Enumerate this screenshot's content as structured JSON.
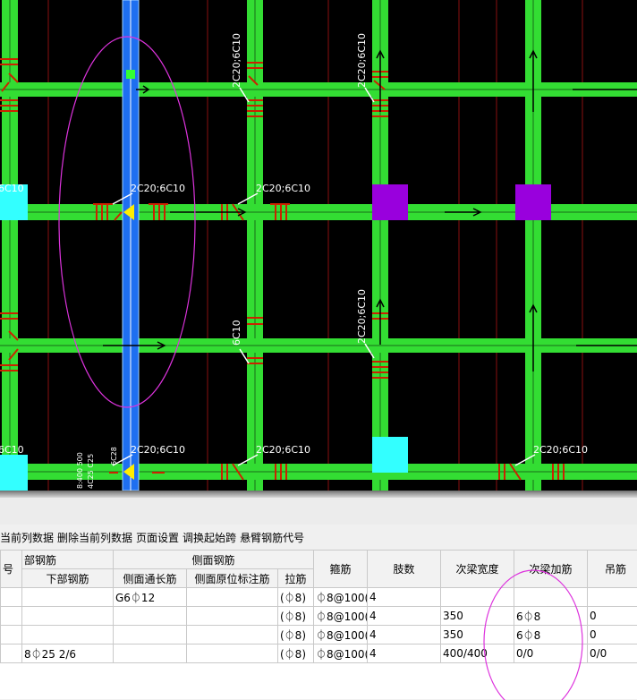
{
  "drawing": {
    "beam_labels": {
      "vertical_a": "2C20;6C10",
      "vertical_b": "2C20;6C10",
      "vertical_c": "2C20;6C10",
      "vertical_d": "6C10",
      "horizontal_a": "2C20;6C10",
      "horizontal_b": "2C20;6C10",
      "horizontal_c": "2C20;6C10",
      "horizontal_d": "2C20;6C10",
      "horizontal_e": "2C20;6C10",
      "edge_a": "6C10",
      "edge_b": "6C10",
      "bottom_small_a": "6C28",
      "bottom_small_b": "8:400 500",
      "bottom_small_c": "4C25 C25"
    },
    "colors": {
      "background": "#000000",
      "beam": "#33dd33",
      "selected_beam": "#1e6ff0",
      "column_cyan": "#33ffff",
      "column_purple": "#9900dd",
      "rebar_marks": "#cc2200",
      "axis_lines": "#8a1010",
      "selection_ellipse": "#dd33dd"
    }
  },
  "toolbar": {
    "items": [
      "当前列数据",
      "删除当前列数据",
      "页面设置",
      "调换起始跨",
      "悬臂钢筋代号"
    ]
  },
  "grid": {
    "group_headers": {
      "col0": "号",
      "bottom_rebar_group": "部钢筋",
      "side_rebar_group": "侧面钢筋"
    },
    "columns": {
      "bottom_rebar": "下部钢筋",
      "side_through": "侧面通长筋",
      "side_original": "侧面原位标注筋",
      "tie_bar": "拉筋",
      "stirrup": "箍筋",
      "legs": "肢数",
      "sec_beam_width": "次梁宽度",
      "sec_beam_rebar": "次梁加筋",
      "hanger": "吊筋"
    },
    "rows": [
      {
        "c0": "",
        "bottom": "",
        "side_through": "G6⏀12",
        "side_original": "",
        "tie": "(⏀8)",
        "stirrup": "⏀8@100(",
        "legs": "4",
        "width": "",
        "sec": "",
        "hanger": ""
      },
      {
        "c0": "",
        "bottom": "",
        "side_through": "",
        "side_original": "",
        "tie": "(⏀8)",
        "stirrup": "⏀8@100(",
        "legs": "4",
        "width": "350",
        "sec": "6⏀8",
        "hanger": "0"
      },
      {
        "c0": "",
        "bottom": "",
        "side_through": "",
        "side_original": "",
        "tie": "(⏀8)",
        "stirrup": "⏀8@100(",
        "legs": "4",
        "width": "350",
        "sec": "6⏀8",
        "hanger": "0"
      },
      {
        "c0": "",
        "bottom": "8⏀25 2/6",
        "side_through": "",
        "side_original": "",
        "tie": "(⏀8)",
        "stirrup": "⏀8@100(",
        "legs": "4",
        "width": "400/400",
        "sec": "0/0",
        "hanger": "0/0"
      }
    ]
  }
}
